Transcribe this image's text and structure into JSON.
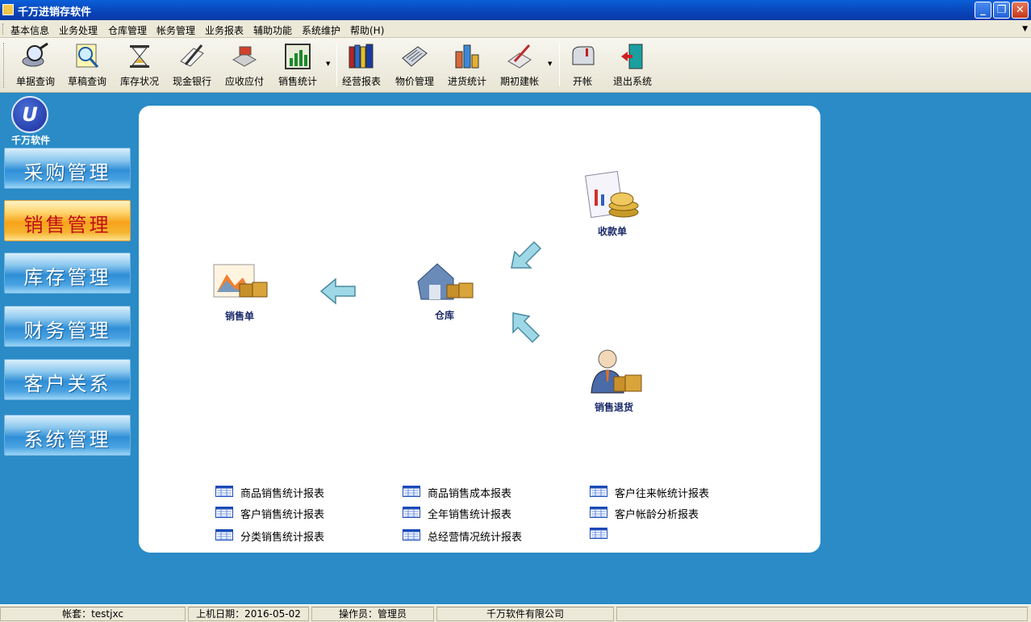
{
  "window": {
    "title": "千万进销存软件",
    "buttons": [
      "_",
      "❐",
      "✕"
    ]
  },
  "menu": [
    "基本信息",
    "业务处理",
    "仓库管理",
    "帐务管理",
    "业务报表",
    "辅助功能",
    "系统维护",
    "帮助(H)"
  ],
  "toolbar": [
    {
      "label": "单据查询",
      "icon": "magnifier-disk-icon"
    },
    {
      "label": "草稿查询",
      "icon": "magnifier-doc-icon"
    },
    {
      "label": "库存状况",
      "icon": "hourglass-icon"
    },
    {
      "label": "现金银行",
      "icon": "pen-paper-icon"
    },
    {
      "label": "应收应付",
      "icon": "stamp-icon"
    },
    {
      "label": "销售统计",
      "icon": "bar-chart-icon"
    },
    {
      "label": "经营报表",
      "icon": "books-icon"
    },
    {
      "label": "物价管理",
      "icon": "calculator-icon"
    },
    {
      "label": "进货统计",
      "icon": "boxes-chart-icon"
    },
    {
      "label": "期初建帐",
      "icon": "pen-check-icon"
    },
    {
      "label": "开帐",
      "icon": "mailbox-icon"
    },
    {
      "label": "退出系统",
      "icon": "exit-door-icon"
    }
  ],
  "logo": {
    "mark": "U",
    "name": "千万软件"
  },
  "nav": [
    {
      "label": "采购管理",
      "active": false
    },
    {
      "label": "销售管理",
      "active": true
    },
    {
      "label": "库存管理",
      "active": false
    },
    {
      "label": "财务管理",
      "active": false
    },
    {
      "label": "客户关系",
      "active": false
    },
    {
      "label": "系统管理",
      "active": false
    }
  ],
  "flow": {
    "sales_order": "销售单",
    "warehouse": "仓库",
    "receipt": "收款单",
    "sales_return": "销售退货"
  },
  "reports": [
    [
      "商品销售统计报表",
      "商品销售成本报表",
      "客户往来帐统计报表"
    ],
    [
      "客户销售统计报表",
      "全年销售统计报表",
      "客户帐龄分析报表"
    ],
    [
      "分类销售统计报表",
      "总经营情况统计报表",
      ""
    ]
  ],
  "status": {
    "account": "帐套：testjxc",
    "login_date": "上机日期：2016-05-02",
    "operator": "操作员：管理员",
    "company": "千万软件有限公司"
  },
  "colors": {
    "background": "#2a8bc6",
    "active_nav": "#f7a21a",
    "titlebar": "#0a5fd8"
  }
}
